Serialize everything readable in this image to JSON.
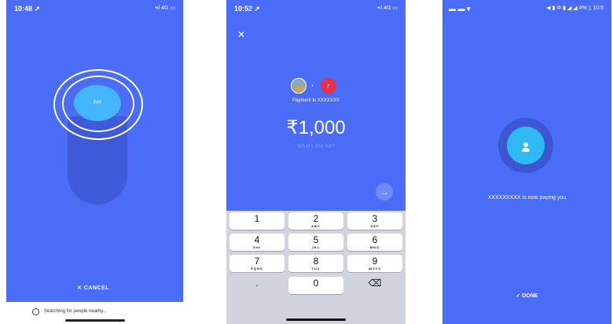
{
  "screen1": {
    "time": "10:48 ➚",
    "status_right": "•ıl 4G ▭",
    "pay_label": "PAY",
    "cancel_label": "CANCEL",
    "cancel_icon": "close-icon",
    "searching_text": "Searching for people nearby...",
    "colors": {
      "background": "#4a6cf7",
      "pay_button": "#43b6ff"
    }
  },
  "screen2": {
    "time": "10:52 ➚",
    "status_right": "•ıl 4G ▭",
    "close_icon": "close-icon",
    "recipient_initial": "r",
    "payment_to": "Payment to XXXXXXX",
    "amount": "₹1,000",
    "purpose_placeholder": "What's this for?",
    "next_icon": "arrow-right-icon",
    "keys": [
      {
        "num": "1",
        "letters": ""
      },
      {
        "num": "2",
        "letters": "ABC"
      },
      {
        "num": "3",
        "letters": "DEF"
      },
      {
        "num": "4",
        "letters": "GHI"
      },
      {
        "num": "5",
        "letters": "JKL"
      },
      {
        "num": "6",
        "letters": "MNO"
      },
      {
        "num": "7",
        "letters": "PQRS"
      },
      {
        "num": "8",
        "letters": "TUV"
      },
      {
        "num": "9",
        "letters": "WXYZ"
      },
      {
        "num": ".",
        "letters": ""
      },
      {
        "num": "0",
        "letters": ""
      },
      {
        "num": "⌫",
        "letters": ""
      }
    ]
  },
  "screen3": {
    "status_left": "▬ ▬ ▾",
    "status_right": "◀ ▮ ✲ ▮ ◢ ◢ 4% ▯ 10:5",
    "paying_text": "XXXXXXXXX is now paying you",
    "done_label": "✓ DONE",
    "person_icon": "person-icon"
  }
}
